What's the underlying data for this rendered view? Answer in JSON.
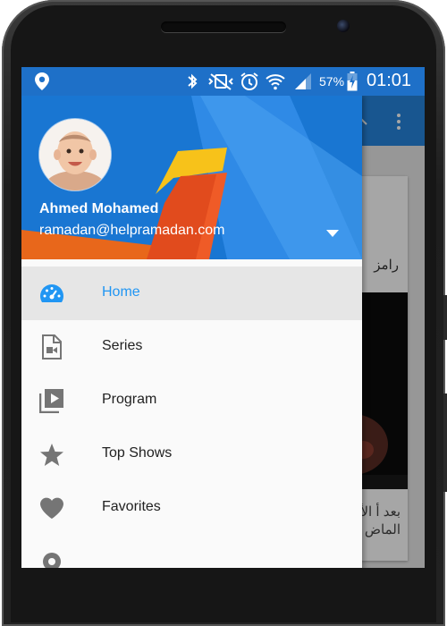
{
  "status_bar": {
    "battery": "57%",
    "time": "01:01",
    "icons": [
      "location-icon",
      "bluetooth-icon",
      "vibrate-icon",
      "alarm-icon",
      "wifi-icon",
      "signal-icon",
      "battery-charging-icon"
    ]
  },
  "drawer": {
    "user_name": "Ahmed Mohamed",
    "user_email": "ramadan@helpramadan.com",
    "items": [
      {
        "label": "Home",
        "icon": "dashboard-icon",
        "active": true
      },
      {
        "label": "Series",
        "icon": "video-file-icon",
        "active": false
      },
      {
        "label": "Program",
        "icon": "video-library-icon",
        "active": false
      },
      {
        "label": "Top Shows",
        "icon": "star-icon",
        "active": false
      },
      {
        "label": "Favorites",
        "icon": "heart-icon",
        "active": false
      }
    ]
  },
  "background_app": {
    "card_title": "رامز",
    "card_text": "بعد أ الأسد الماض"
  },
  "colors": {
    "primary": "#1976d2",
    "toolbar": "#2585de",
    "active_label": "#2196f3",
    "orange": "#e8671b",
    "yellow": "#f7c21a"
  }
}
